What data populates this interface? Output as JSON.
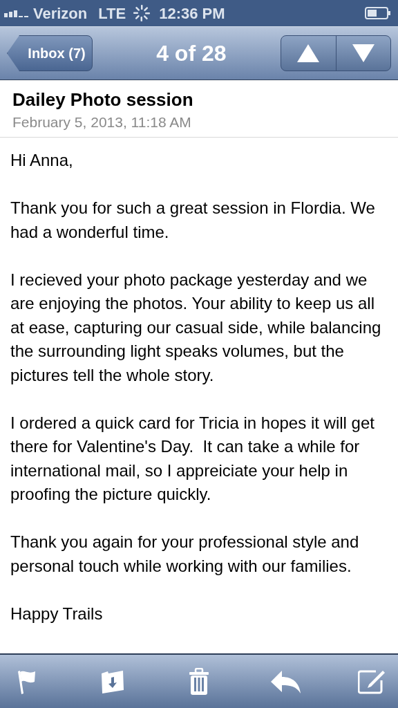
{
  "status_bar": {
    "carrier": "Verizon",
    "network": "LTE",
    "time": "12:36 PM"
  },
  "nav_bar": {
    "back": "Inbox (7)",
    "title": "4 of 28"
  },
  "message": {
    "subject": "Dailey Photo session",
    "date": "February 5, 2013, 11:18 AM",
    "paragraphs": [
      "Hi Anna,",
      "Thank you for such a great session in Flordia. We had a wonderful time.",
      "I recieved your photo package yesterday and we are enjoying the photos. Your ability to keep us all at ease, capturing our casual side, while balancing the surrounding light speaks volumes, but the pictures tell the whole story.",
      "I ordered a quick card for Tricia in hopes it will get there for Valentine's Day.  It can take a while for international mail, so I appreiciate your help in proofing the picture quickly.",
      "Thank you again for your professional style and personal touch while working with our families.",
      "Happy Trails"
    ]
  }
}
